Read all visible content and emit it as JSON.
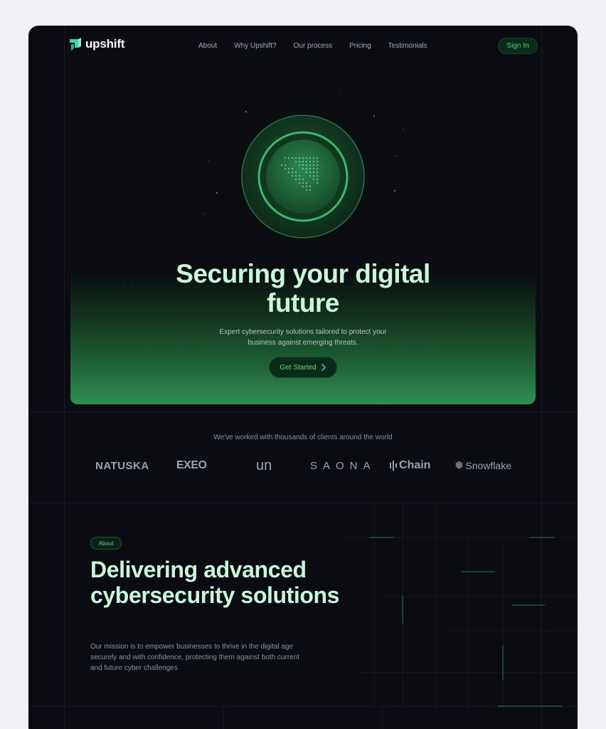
{
  "brand": {
    "name": "upshift",
    "accent": "#43d17d"
  },
  "nav": {
    "items": [
      "About",
      "Why Upshift?",
      "Our process",
      "Pricing",
      "Testimonials"
    ],
    "signin_label": "Sign In"
  },
  "hero": {
    "title": "Securing your digital future",
    "subtitle": "Expert cybersecurity solutions tailored to protect your business against emerging threats.",
    "cta_label": "Get Started",
    "cta_icon": "chevron-right-icon"
  },
  "clients": {
    "caption": "We've worked with thousands of clients around the world",
    "logos": [
      "NATUSKA",
      "EXEO",
      "un",
      "SAONA",
      "Chain",
      "Snowflake"
    ]
  },
  "about": {
    "badge": "About",
    "title": "Delivering advanced cybersecurity solutions",
    "text": "Our mission is to empower businesses to thrive in the digital age securely and with confidence, protecting them against both current and future cyber challenges"
  }
}
